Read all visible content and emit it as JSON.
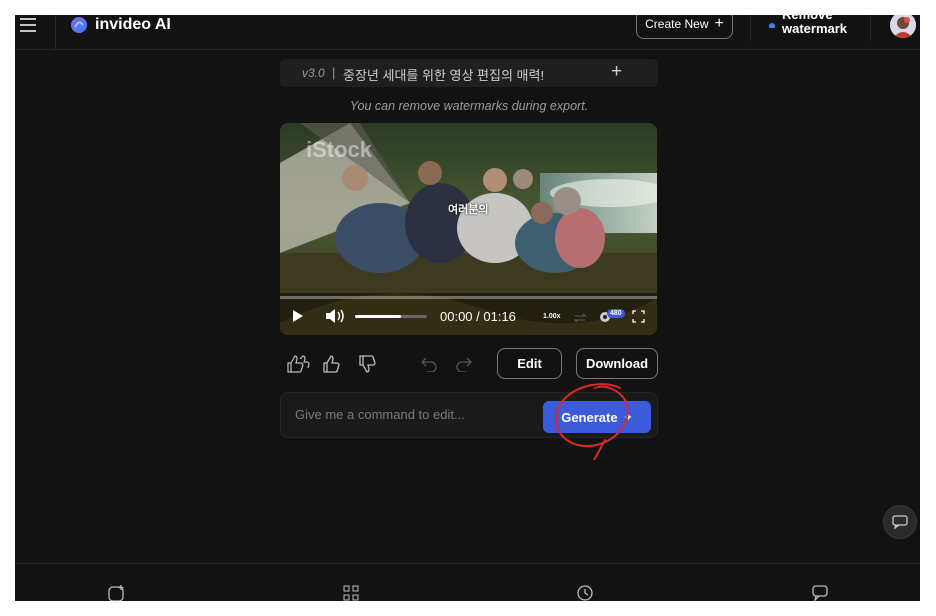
{
  "header": {
    "app_name": "invideo AI",
    "create_new_label": "Create New",
    "remove_watermark_line1": "Remove",
    "remove_watermark_line2": "watermark"
  },
  "version_bar": {
    "version": "v3.0",
    "separator": "|",
    "title": "중장년 세대를 위한 영상 편집의 매력!"
  },
  "notice": "You can remove watermarks during export.",
  "video": {
    "watermark_text": "iStock",
    "caption": "여러분의",
    "time": "00:00 / 01:16",
    "speed": "1.00x",
    "quality": "480"
  },
  "actions": {
    "edit_label": "Edit",
    "download_label": "Download"
  },
  "prompt": {
    "placeholder": "Give me a command to edit...",
    "generate_label": "Generate"
  },
  "colors": {
    "background": "#121212",
    "accent": "#3b5bdb",
    "annotation": "#d42a2a"
  }
}
